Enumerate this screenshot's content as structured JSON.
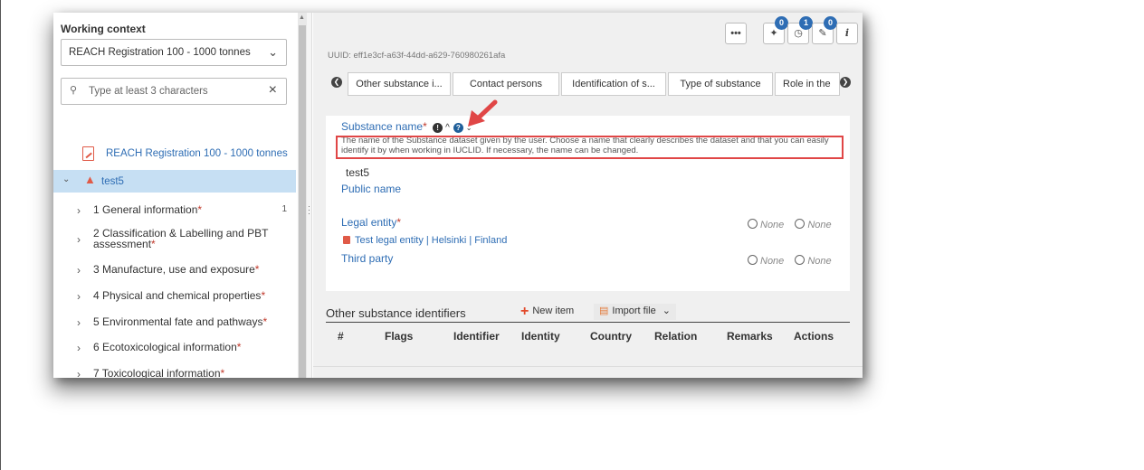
{
  "sidebar": {
    "working_context_label": "Working context",
    "working_context_value": "REACH Registration 100 - 1000 tonnes",
    "search_placeholder": "Type at least 3 characters",
    "root_item_label": "REACH Registration 100 - 1000 tonnes",
    "selected_item_label": "test5",
    "tree_items": [
      {
        "label": "1 General information",
        "required": "*",
        "count": "1"
      },
      {
        "label": "2 Classification & Labelling and PBT assessment",
        "required": "*",
        "count": ""
      },
      {
        "label": "3 Manufacture, use and exposure",
        "required": "*",
        "count": ""
      },
      {
        "label": "4 Physical and chemical properties",
        "required": "*",
        "count": ""
      },
      {
        "label": "5 Environmental fate and pathways",
        "required": "*",
        "count": ""
      },
      {
        "label": "6 Ecotoxicological information",
        "required": "*",
        "count": ""
      },
      {
        "label": "7 Toxicological information",
        "required": "*",
        "count": ""
      }
    ]
  },
  "toolbar": {
    "more_label": "•••",
    "badge_1": "0",
    "badge_2": "1",
    "badge_3": "0",
    "info_label": "i"
  },
  "main": {
    "uuid": "UUID: eff1e3cf-a63f-44dd-a629-760980261afa",
    "tabs": [
      {
        "label": "Other substance i..."
      },
      {
        "label": "Contact persons"
      },
      {
        "label": "Identification of s..."
      },
      {
        "label": "Type of substance"
      },
      {
        "label": "Role in the"
      }
    ],
    "substance_name_label": "Substance name",
    "required_mark": "*",
    "help_text": "The name of the Substance dataset given by the user. Choose a name that clearly describes the dataset and that you can easily identify it by when working in IUCLID. If necessary, the name can be changed.",
    "substance_name_value": "test5",
    "public_name_label": "Public name",
    "legal_entity_label": "Legal entity",
    "legal_entity_value": "Test legal entity | Helsinki | Finland",
    "third_party_label": "Third party",
    "none_label": "None",
    "other_identifiers_title": "Other substance identifiers",
    "new_item_label": "New item",
    "import_file_label": "Import file",
    "table_headers": [
      "#",
      "Flags",
      "Identifier",
      "Identity",
      "Country",
      "Relation",
      "Remarks",
      "Actions"
    ]
  },
  "colors": {
    "accent_blue": "#2e6db4",
    "required_red": "#c0392b",
    "highlight_box": "#e04646",
    "selected_row": "#c6dff3"
  }
}
